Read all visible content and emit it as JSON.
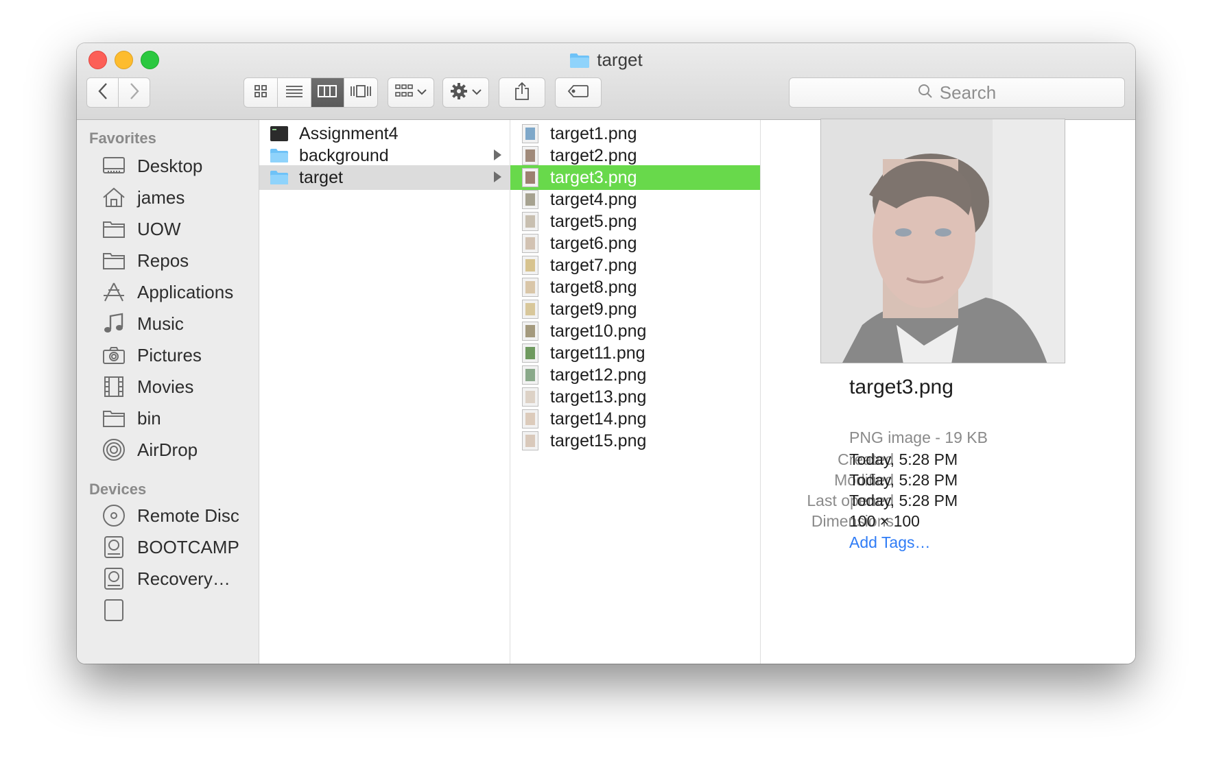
{
  "window": {
    "title": "target"
  },
  "toolbar": {
    "search_placeholder": "Search"
  },
  "sidebar": {
    "favorites_header": "Favorites",
    "favorites": [
      {
        "label": "Desktop",
        "icon": "desktop-icon"
      },
      {
        "label": "james",
        "icon": "home-icon"
      },
      {
        "label": "UOW",
        "icon": "folder-icon"
      },
      {
        "label": "Repos",
        "icon": "folder-icon"
      },
      {
        "label": "Applications",
        "icon": "applications-icon"
      },
      {
        "label": "Music",
        "icon": "music-icon"
      },
      {
        "label": "Pictures",
        "icon": "camera-icon"
      },
      {
        "label": "Movies",
        "icon": "film-icon"
      },
      {
        "label": "bin",
        "icon": "folder-icon"
      },
      {
        "label": "AirDrop",
        "icon": "airdrop-icon"
      }
    ],
    "devices_header": "Devices",
    "devices": [
      {
        "label": "Remote Disc",
        "icon": "disc-icon"
      },
      {
        "label": "BOOTCAMP",
        "icon": "drive-icon"
      },
      {
        "label": "Recovery…",
        "icon": "drive-icon"
      }
    ]
  },
  "column1": {
    "items": [
      {
        "label": "Assignment4",
        "icon": "terminal-icon"
      },
      {
        "label": "background",
        "icon": "folder-icon"
      },
      {
        "label": "target",
        "icon": "folder-icon"
      }
    ]
  },
  "column2": {
    "items": [
      {
        "label": "target1.png"
      },
      {
        "label": "target2.png"
      },
      {
        "label": "target3.png"
      },
      {
        "label": "target4.png"
      },
      {
        "label": "target5.png"
      },
      {
        "label": "target6.png"
      },
      {
        "label": "target7.png"
      },
      {
        "label": "target8.png"
      },
      {
        "label": "target9.png"
      },
      {
        "label": "target10.png"
      },
      {
        "label": "target11.png"
      },
      {
        "label": "target12.png"
      },
      {
        "label": "target13.png"
      },
      {
        "label": "target14.png"
      },
      {
        "label": "target15.png"
      }
    ]
  },
  "preview": {
    "name": "target3.png",
    "kind": "PNG image - 19 KB",
    "meta": [
      {
        "key": "Created",
        "value": "Today, 5:28 PM"
      },
      {
        "key": "Modified",
        "value": "Today, 5:28 PM"
      },
      {
        "key": "Last opened",
        "value": "Today, 5:28 PM"
      },
      {
        "key": "Dimensions",
        "value": "100 × 100"
      }
    ],
    "add_tags": "Add Tags…"
  },
  "colors": {
    "selection_green": "#68d94b",
    "selection_gray": "#dcdcdc",
    "link_blue": "#2f7cf6"
  }
}
